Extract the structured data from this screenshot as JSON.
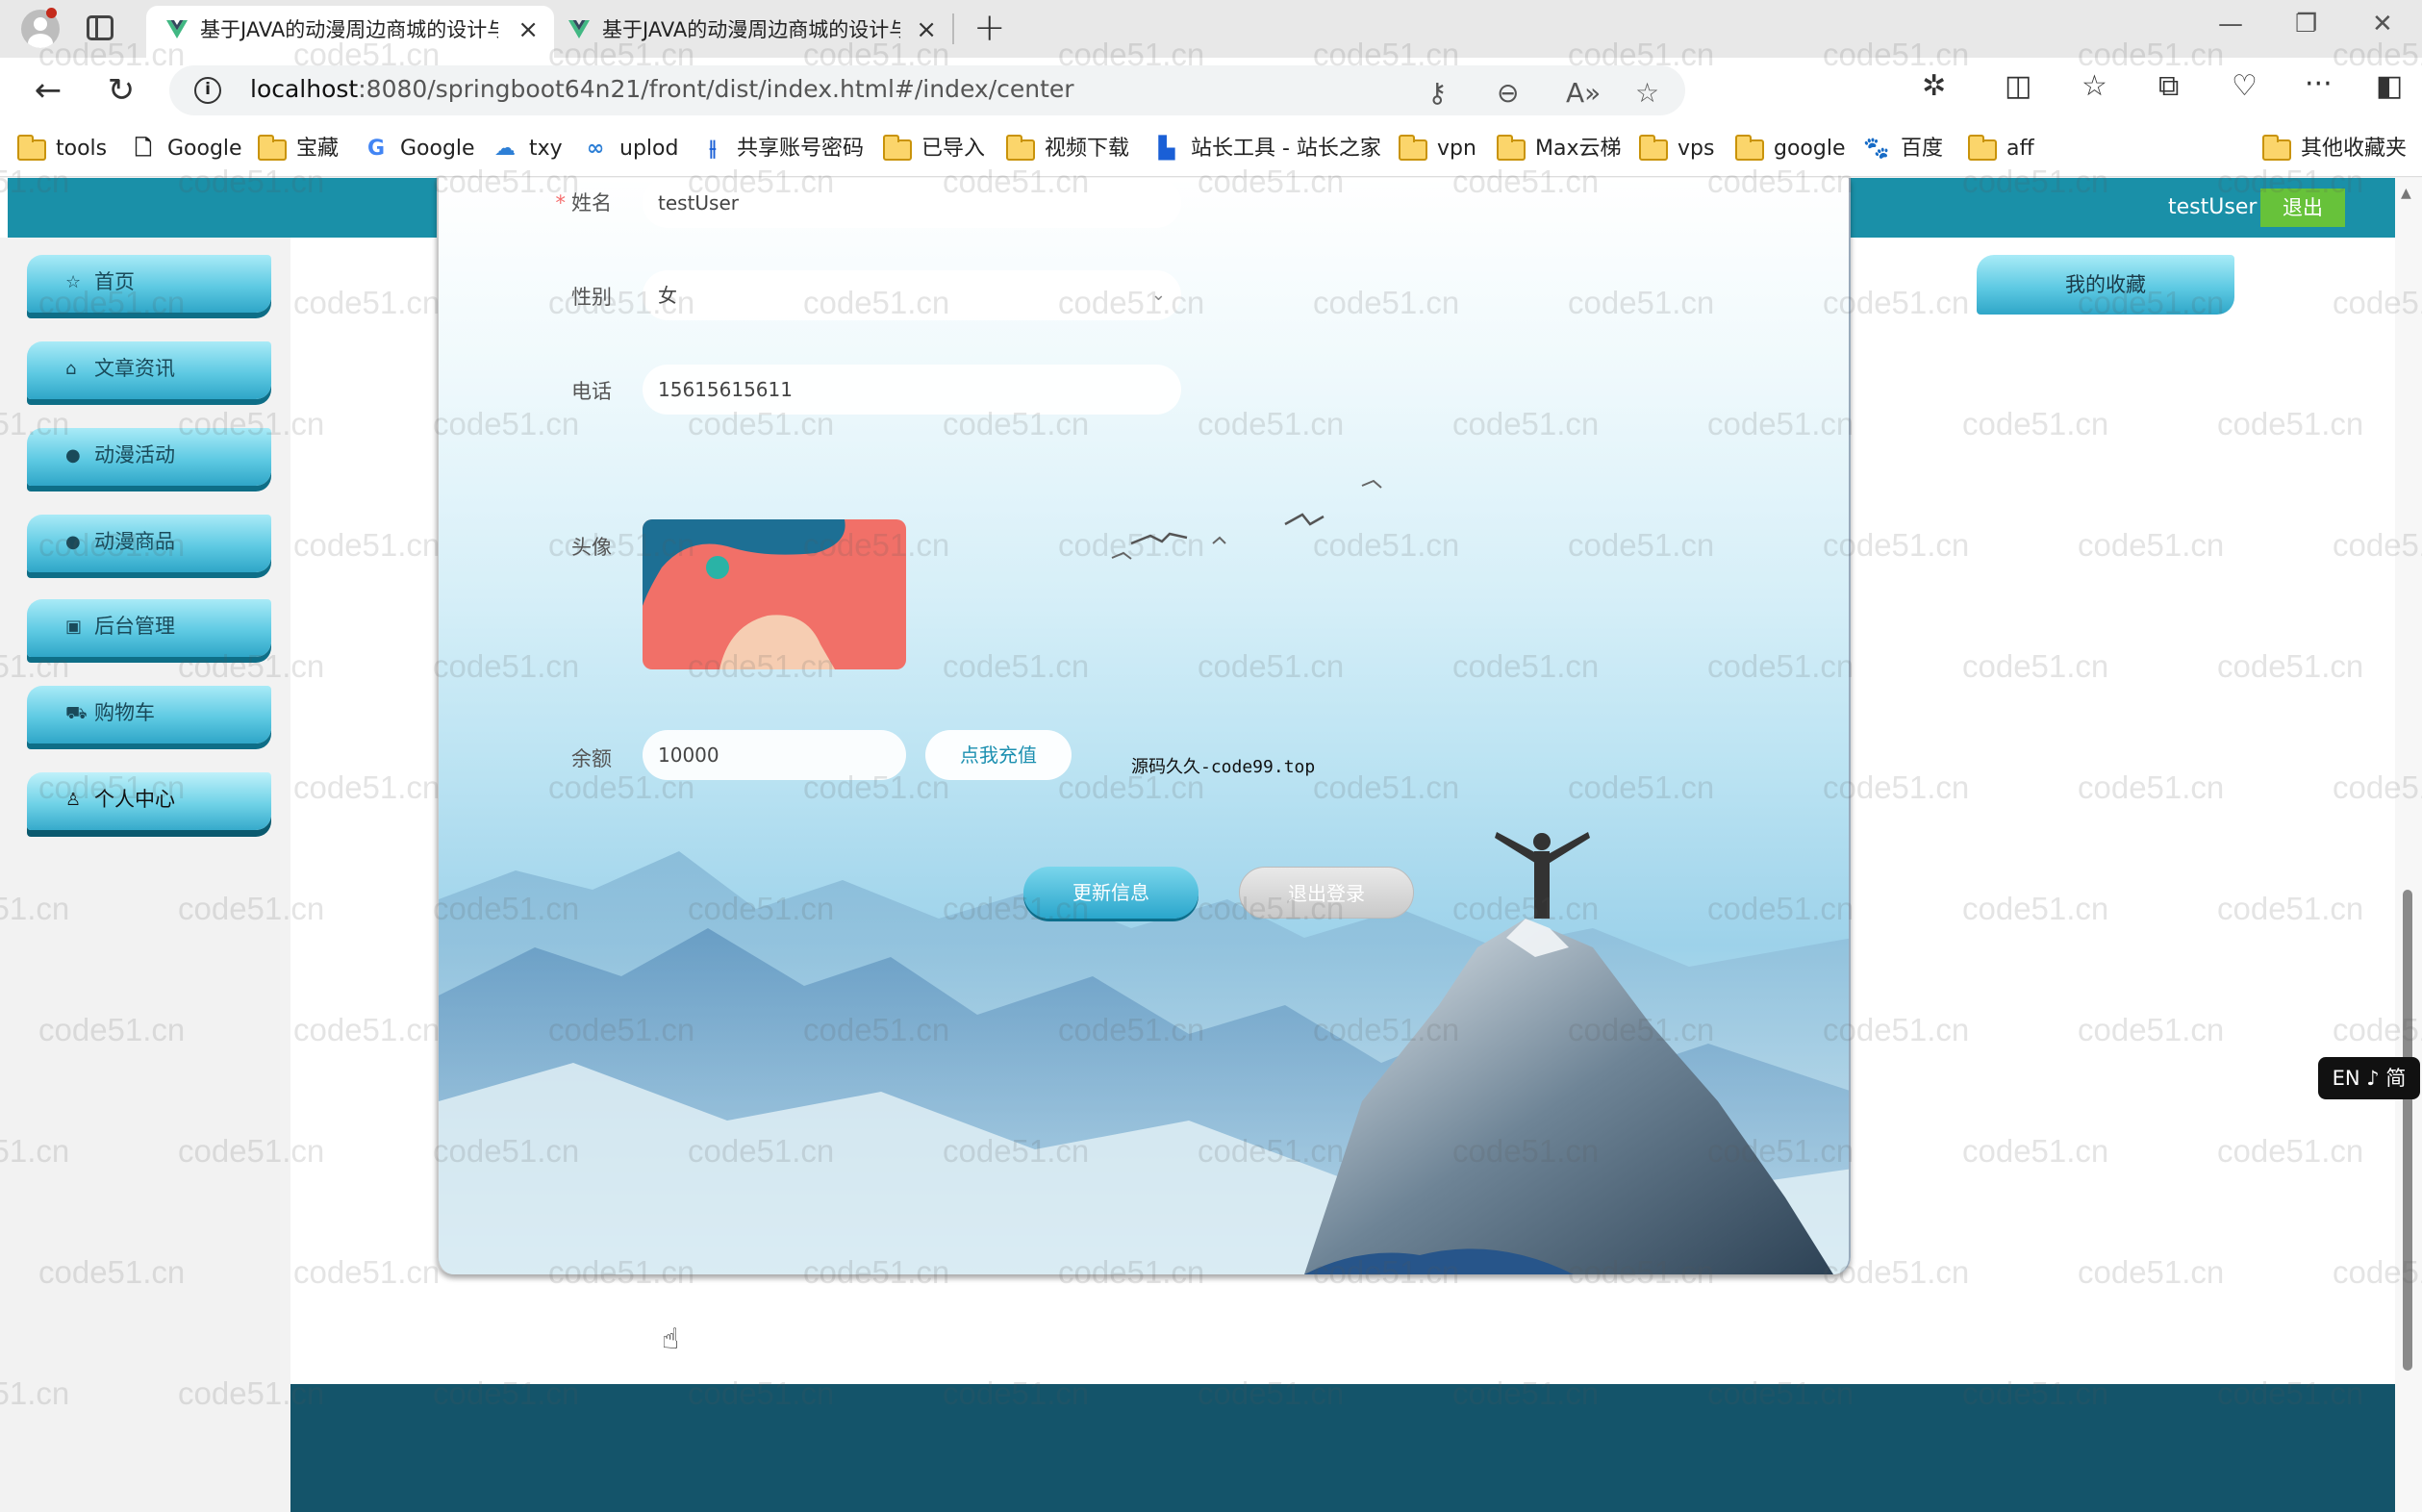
{
  "browser": {
    "tabs": [
      {
        "title": "基于JAVA的动漫周边商城的设计与实现",
        "active": true
      },
      {
        "title": "基于JAVA的动漫周边商城的设计与实现",
        "active": false
      }
    ],
    "url_host": "localhost",
    "url_rest": ":8080/springboot64n21/front/dist/index.html#/index/center",
    "bookmarks": [
      {
        "label": "tools",
        "icon": "folder-icon"
      },
      {
        "label": "Google",
        "icon": "page-icon"
      },
      {
        "label": "宝藏",
        "icon": "folder-icon"
      },
      {
        "label": "Google",
        "icon": "google-icon"
      },
      {
        "label": "txy",
        "icon": "cloud-icon"
      },
      {
        "label": "uplod",
        "icon": "upload-icon"
      },
      {
        "label": "共享账号密码",
        "icon": "share-icon"
      },
      {
        "label": "已导入",
        "icon": "folder-icon"
      },
      {
        "label": "视频下载",
        "icon": "folder-icon"
      },
      {
        "label": "站长工具 - 站长之家",
        "icon": "site-icon"
      },
      {
        "label": "vpn",
        "icon": "folder-icon"
      },
      {
        "label": "Max云梯",
        "icon": "folder-icon"
      },
      {
        "label": "vps",
        "icon": "folder-icon"
      },
      {
        "label": "google",
        "icon": "folder-icon"
      },
      {
        "label": "百度",
        "icon": "baidu-icon"
      },
      {
        "label": "aff",
        "icon": "folder-icon"
      }
    ],
    "other_bookmarks": "其他收藏夹"
  },
  "header": {
    "title": "基于JAVA的动漫周边商城的设计与实现",
    "username": "testUser",
    "logout": "退出"
  },
  "sidebar": {
    "items": [
      {
        "label": "首页",
        "icon": "star-icon"
      },
      {
        "label": "文章资讯",
        "icon": "home-icon"
      },
      {
        "label": "动漫活动",
        "icon": "info-icon"
      },
      {
        "label": "动漫商品",
        "icon": "help-icon"
      },
      {
        "label": "后台管理",
        "icon": "briefcase-icon"
      },
      {
        "label": "购物车",
        "icon": "cart-icon"
      },
      {
        "label": "个人中心",
        "icon": "user-icon",
        "active": true
      }
    ]
  },
  "form": {
    "name_label": "姓名",
    "name_value": "testUser",
    "gender_label": "性别",
    "gender_value": "女",
    "phone_label": "电话",
    "phone_value": "15615615611",
    "avatar_label": "头像",
    "balance_label": "余额",
    "balance_value": "10000",
    "recharge": "点我充值",
    "note": "源码久久-code99.top",
    "update_button": "更新信息",
    "logout_button": "退出登录"
  },
  "right_panel": {
    "favorites": "我的收藏"
  },
  "ime": "EN ♪ 简",
  "watermark": "code51.cn",
  "colors": {
    "header": "#1a90a8",
    "footer": "#14546a",
    "logout_green": "#67c23a",
    "accent_cyan": "#5ecae3"
  }
}
